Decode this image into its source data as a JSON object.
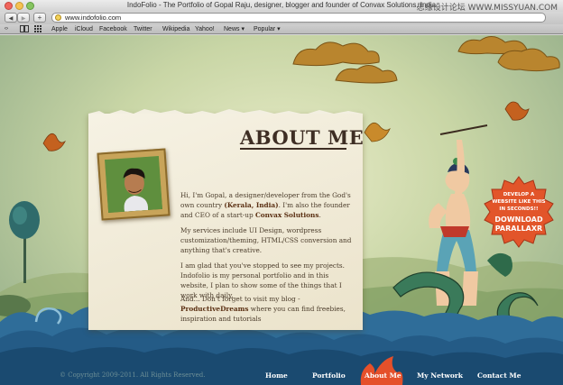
{
  "window": {
    "title": "IndoFolio - The Portfolio of Gopal Raju, designer, blogger and founder of Convax Solutions, India",
    "watermark": "思缘设计论坛 WWW.MISSYUAN.COM"
  },
  "toolbar": {
    "back_glyph": "◀",
    "forward_glyph": "▶",
    "add_glyph": "+",
    "url": "www.indofolio.com"
  },
  "bookmarks": {
    "reader_glyph": "‹›",
    "items": [
      "Apple",
      "iCloud",
      "Facebook",
      "Twitter",
      "Wikipedia",
      "Yahoo!",
      "News ▾",
      "Popular ▾"
    ]
  },
  "about": {
    "heading": "ABOUT ME",
    "p1_intro": "Hi, I'm Gopal, a designer/developer from the God's own country ",
    "p1_loc": "(Kerala, India)",
    "p1_mid": ". I'm also the founder and CEO of a start-up ",
    "p1_company": "Convax Solutions",
    "p1_end": ".",
    "p2": "My services include UI Design, wordpress customization/theming, HTML/CSS conversion and anything that's creative.",
    "p3": "I am glad that you've stopped to see my projects. Indofolio is my personal portfolio and in this website, I plan to show some of the things that I work with daily.",
    "p4_intro": "And... Don't forget to visit my blog - ",
    "p4_blog": "ProductiveDreams",
    "p4_end": " where you can find freebies, inspiration and tutorials"
  },
  "promo": {
    "line1": "DEVELOP A",
    "line2": "WEBSITE LIKE THIS",
    "line3": "IN SECONDS!!",
    "line4": "DOWNLOAD",
    "line5": "PARALLAXR"
  },
  "footer": {
    "copyright": "© Copyright 2009-2011. All Rights Reserved.",
    "nav": [
      "Home",
      "Portfolio",
      "About Me",
      "My Network",
      "Contact Me"
    ],
    "active": "About Me"
  },
  "colors": {
    "sky": "#c9d6a6",
    "wave_dark": "#1d4f7a",
    "paper": "#f1ecdc",
    "heading": "#3e2e24",
    "promo": "#e2552a",
    "active_nav": "#e5502a"
  },
  "icons": [
    "back-icon",
    "forward-icon",
    "add-tab-icon",
    "site-icon",
    "reader-icon",
    "grid-icon",
    "book-icon",
    "bird-icon",
    "cloud-icon",
    "tree-icon",
    "dragon-icon",
    "krishna-figure"
  ]
}
